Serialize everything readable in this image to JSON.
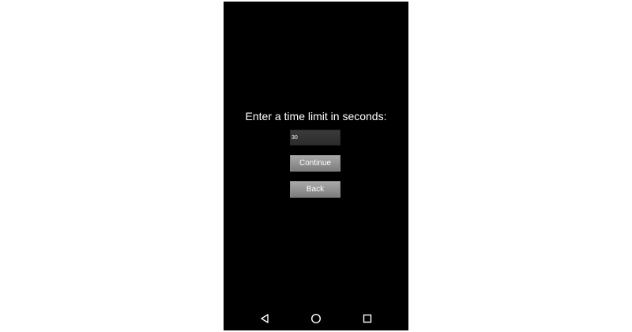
{
  "screen": {
    "prompt": "Enter a time limit in seconds:",
    "time_input": {
      "value": "30",
      "placeholder": ""
    },
    "continue_label": "Continue",
    "back_label": "Back"
  },
  "navbar": {
    "icons": [
      "back-triangle-icon",
      "home-circle-icon",
      "recents-square-icon"
    ]
  },
  "colors": {
    "screen_background": "#000000",
    "page_background": "#ffffff",
    "button_gray": "#9a9a9a",
    "input_dark": "#333333",
    "text": "#ffffff"
  }
}
